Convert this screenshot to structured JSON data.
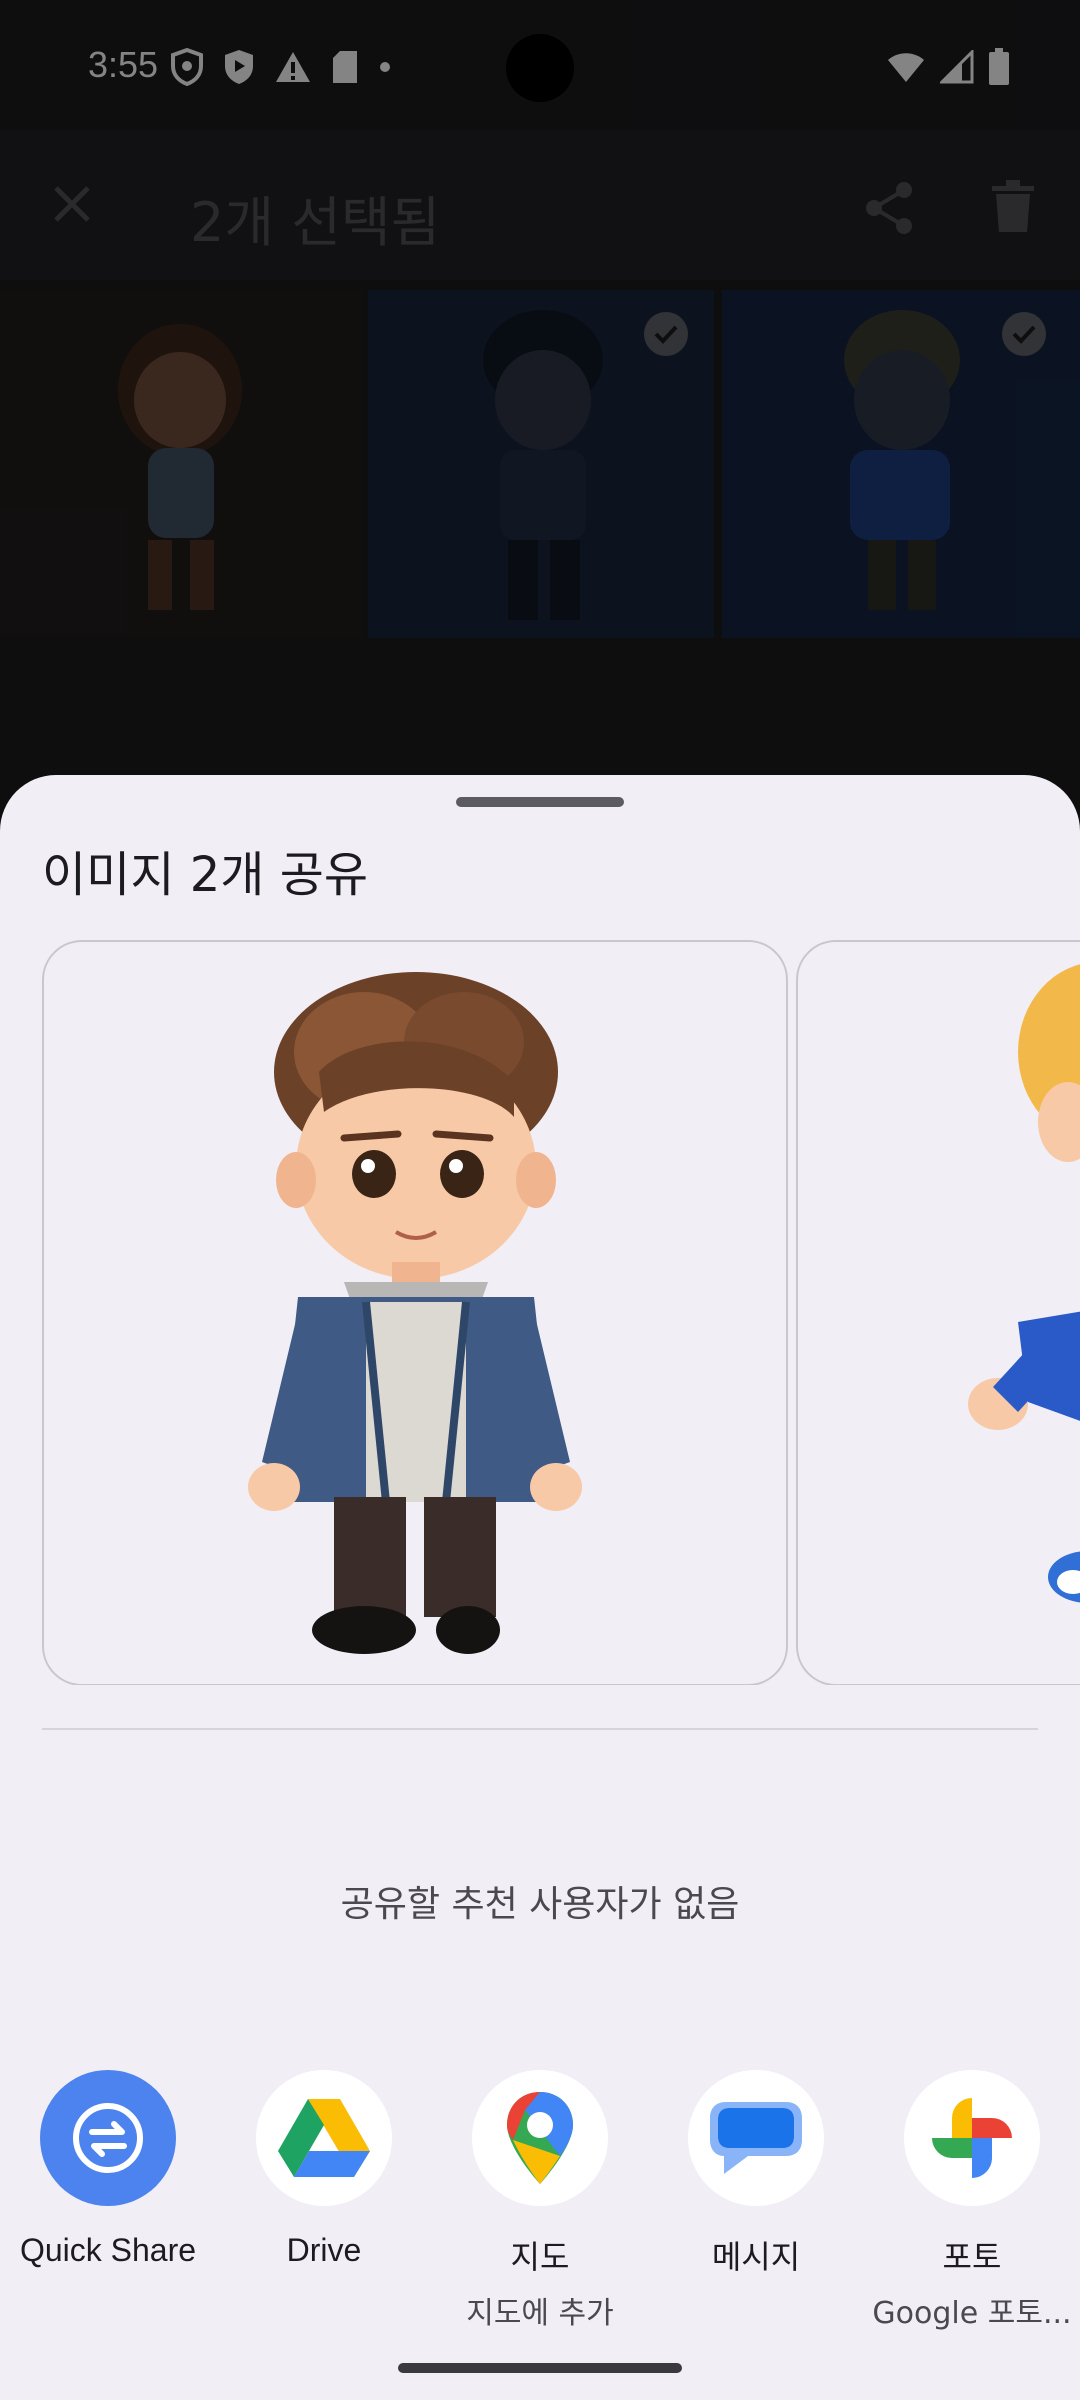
{
  "status_bar": {
    "time": "3:55"
  },
  "app_bar": {
    "title": "2개 선택됨"
  },
  "share_sheet": {
    "title": "이미지 2개 공유",
    "empty_message": "공유할 추천 사용자가 없음",
    "targets": [
      {
        "label": "Quick Share",
        "sub": "",
        "icon": "quick-share-icon"
      },
      {
        "label": "Drive",
        "sub": "",
        "icon": "google-drive-icon"
      },
      {
        "label": "지도",
        "sub": "지도에 추가",
        "icon": "google-maps-icon"
      },
      {
        "label": "메시지",
        "sub": "",
        "icon": "messages-icon"
      },
      {
        "label": "포토",
        "sub": "Google 포토...",
        "icon": "google-photos-icon"
      }
    ]
  },
  "colors": {
    "sheet_bg": "#f1eff5",
    "quick_share": "#4c83ef",
    "messages_blue": "#1a73e8"
  }
}
